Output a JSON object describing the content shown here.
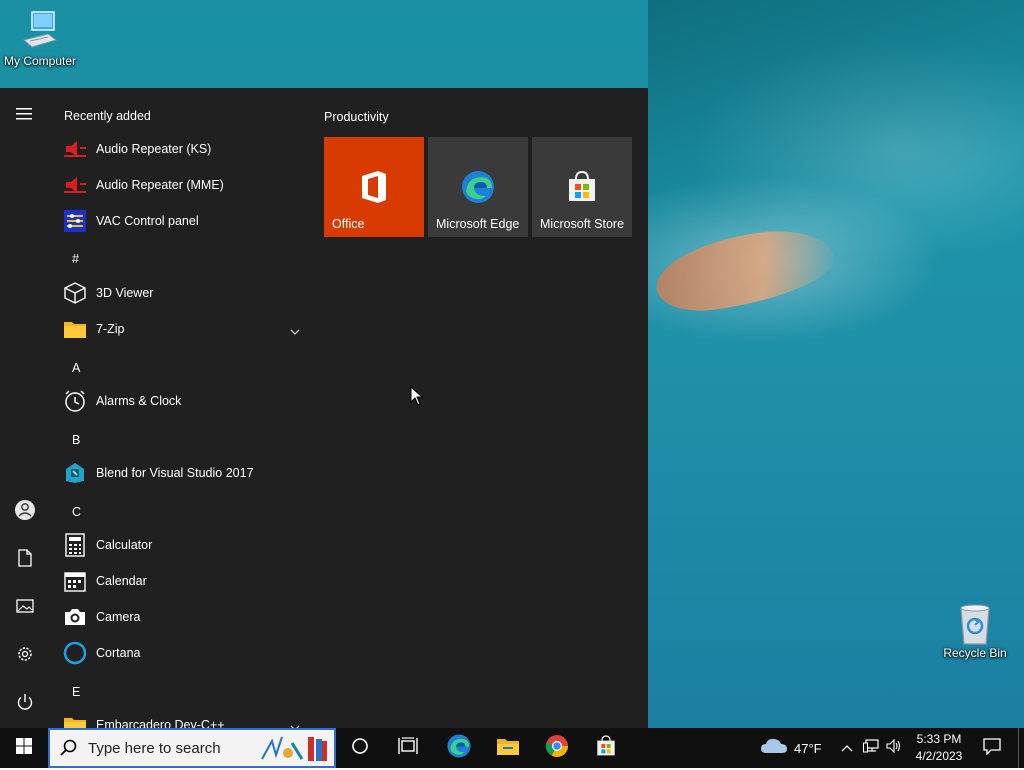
{
  "desktop": {
    "icons": [
      {
        "label": "My Computer",
        "icon": "computer-icon"
      },
      {
        "label": "Recycle Bin",
        "icon": "recycle-bin-icon"
      }
    ]
  },
  "start_menu": {
    "recently_added_title": "Recently added",
    "recent": [
      {
        "label": "Audio Repeater (KS)",
        "icon": "audio-repeater-icon"
      },
      {
        "label": "Audio Repeater (MME)",
        "icon": "audio-repeater-icon"
      },
      {
        "label": "VAC Control panel",
        "icon": "vac-control-icon"
      }
    ],
    "letters": [
      "#",
      "A",
      "B",
      "C",
      "E"
    ],
    "apps": [
      {
        "label": "3D Viewer",
        "icon": "cube-icon"
      },
      {
        "label": "7-Zip",
        "icon": "folder-icon"
      },
      {
        "label": "Alarms & Clock",
        "icon": "clock-icon"
      },
      {
        "label": "Blend for Visual Studio 2017",
        "icon": "blend-icon"
      },
      {
        "label": "Calculator",
        "icon": "calculator-icon"
      },
      {
        "label": "Calendar",
        "icon": "calendar-icon"
      },
      {
        "label": "Camera",
        "icon": "camera-icon"
      },
      {
        "label": "Cortana",
        "icon": "cortana-icon"
      },
      {
        "label": "Embarcadero Dev-C++",
        "icon": "folder-icon"
      }
    ],
    "tiles_group": "Productivity",
    "tiles": [
      {
        "label": "Office",
        "color": "#d83b01"
      },
      {
        "label": "Microsoft Edge",
        "color": "#3a3a3a"
      },
      {
        "label": "Microsoft Store",
        "color": "#3a3a3a"
      }
    ]
  },
  "taskbar": {
    "search_placeholder": "Type here to search",
    "weather_temp": "47°F",
    "time": "5:33 PM",
    "date": "4/2/2023"
  },
  "colors": {
    "accent": "#2f6ed3",
    "office_orange": "#d83b01",
    "menu_bg": "#202020",
    "taskbar_bg": "#101010"
  }
}
